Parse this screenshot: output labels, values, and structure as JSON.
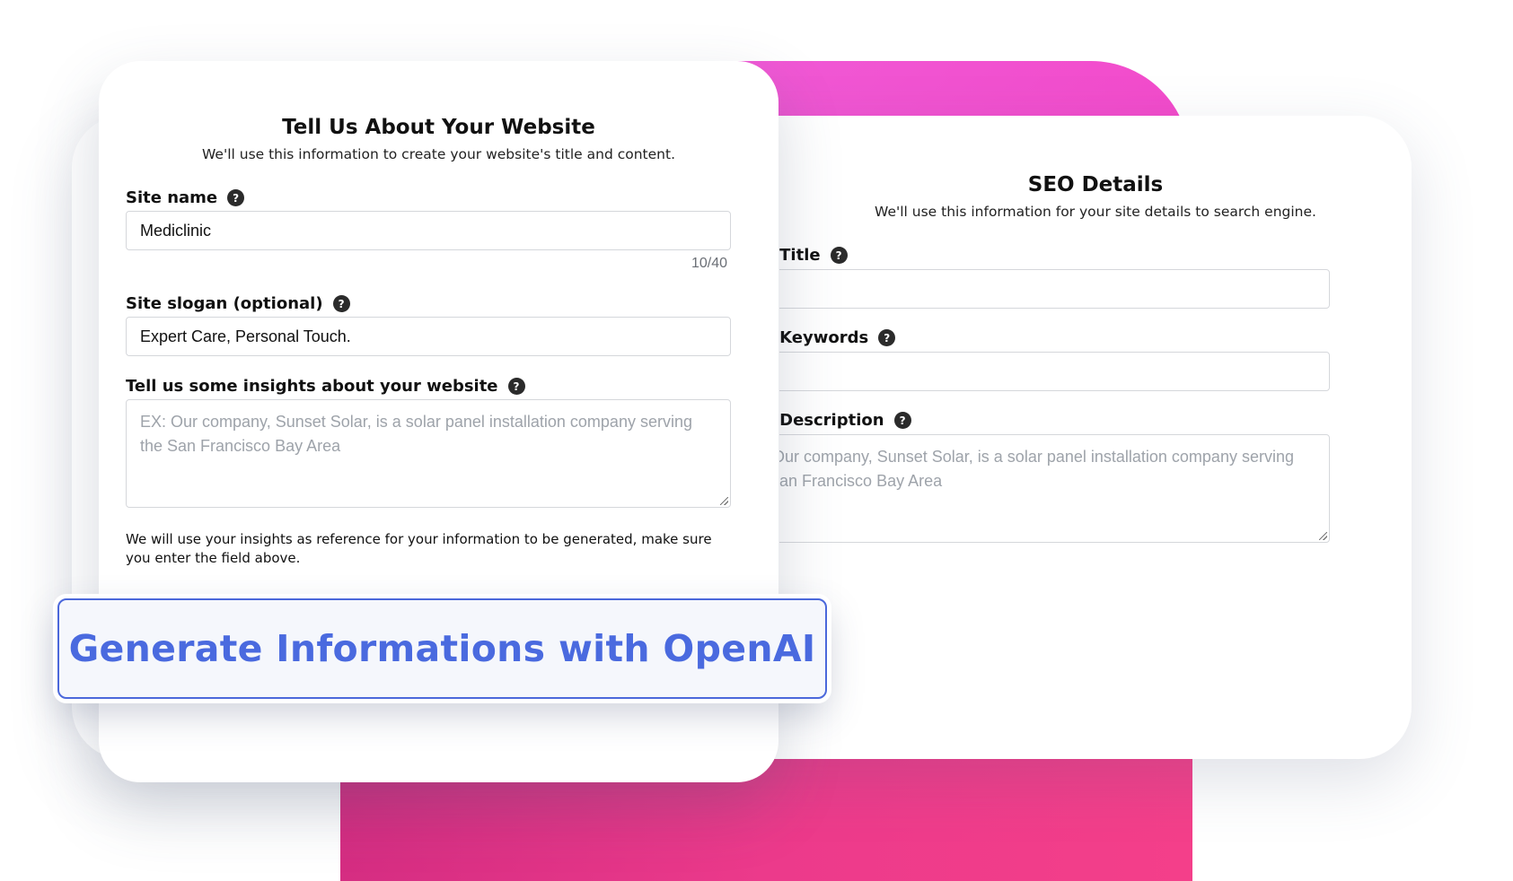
{
  "website_form": {
    "title": "Tell Us About Your Website",
    "subtitle": "We'll use this information to create your website's title and content.",
    "site_name": {
      "label": "Site name",
      "value": "Mediclinic",
      "counter": "10/40"
    },
    "site_slogan": {
      "label": "Site slogan (optional)",
      "value": "Expert Care, Personal Touch."
    },
    "insights": {
      "label": "Tell us some insights about your website",
      "placeholder": "EX: Our company, Sunset Solar, is a solar panel installation company serving the San Francisco Bay Area"
    },
    "note": "We will use your insights as reference for your information to be generated, make sure you enter the field above.",
    "generate_button": "Generate Informations with OpenAI",
    "help_icon": "?"
  },
  "seo_form": {
    "title": "SEO Details",
    "subtitle": "We'll use this information for your site details to search engine.",
    "meta_title": {
      "label": "Meta Title",
      "value": ""
    },
    "meta_keywords": {
      "label": "Meta Keywords",
      "value": ""
    },
    "meta_description": {
      "label": "Meta Description",
      "placeholder": "EX: Our company, Sunset Solar, is a solar panel installation company serving the San Francisco Bay Area"
    },
    "help_icon": "?"
  },
  "colors": {
    "accent": "#4a6adf",
    "pink": "#f24bcb",
    "magenta": "#ec3a8b"
  }
}
